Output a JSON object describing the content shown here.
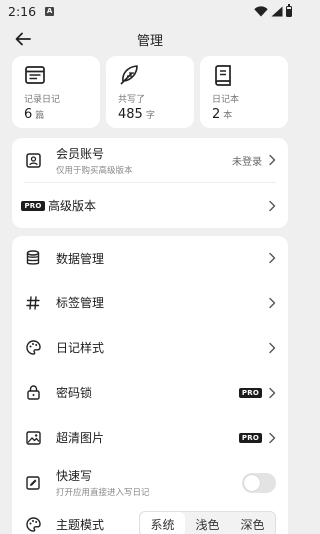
{
  "status_bar": {
    "time": "2:16",
    "notification_letter": "A"
  },
  "header": {
    "title": "管理"
  },
  "stats": [
    {
      "icon": "calendar-icon",
      "label": "记录日记",
      "value": "6",
      "unit": "篇"
    },
    {
      "icon": "feather-icon",
      "label": "共写了",
      "value": "485",
      "unit": "字"
    },
    {
      "icon": "book-icon",
      "label": "日记本",
      "value": "2",
      "unit": "本"
    }
  ],
  "account": {
    "member_title": "会员账号",
    "member_sub": "仅用于购买高级版本",
    "member_status": "未登录",
    "pro_badge": "PRO",
    "premium_title": "高级版本"
  },
  "settings": {
    "data_manage": "数据管理",
    "tag_manage": "标签管理",
    "diary_style": "日记样式",
    "password_lock": "密码锁",
    "hd_images": "超清图片",
    "quick_write_title": "快速写",
    "quick_write_sub": "打开应用直接进入写日记",
    "quick_write_enabled": false,
    "theme_mode": "主题模式",
    "theme_options": [
      "系统",
      "浅色",
      "深色"
    ],
    "theme_selected": "系统"
  }
}
